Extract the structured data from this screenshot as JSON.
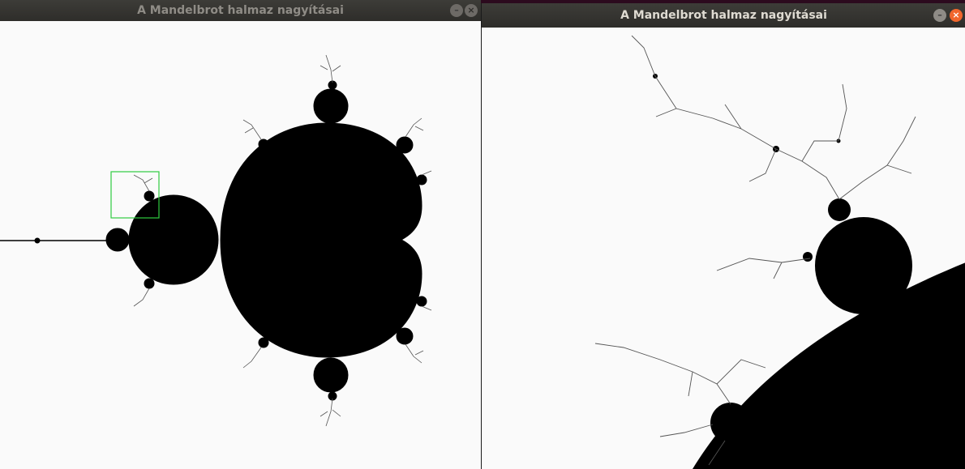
{
  "left_window": {
    "title": "A Mandelbrot halmaz nagyításai",
    "minimize_symbol": "–",
    "close_symbol": "×"
  },
  "right_window": {
    "title": "A Mandelbrot halmaz nagyításai",
    "minimize_symbol": "–",
    "close_symbol": "×"
  },
  "colors": {
    "set": "#000000",
    "background": "#fafafa",
    "selection": "#2ecc40"
  }
}
